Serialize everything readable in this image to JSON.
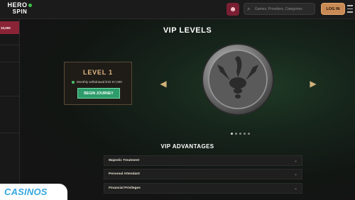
{
  "header": {
    "logo_line1": "HERO",
    "logo_line2": "SPIN",
    "search_placeholder": "Games, Providers, Categories",
    "login_label": "LOG IN",
    "avatar_icon": "profile-icon"
  },
  "sidebar": {
    "promo_text": "10,000"
  },
  "hero": {
    "title": "VIP LEVELS",
    "card": {
      "level": "LEVEL 1",
      "perk": "Monthly withdrawal limit €7,000",
      "button": "BEGIN JOURNEY"
    },
    "medallion_icon": "scorpion-medallion-icon",
    "prev_icon": "arrow-left-icon",
    "next_icon": "arrow-right-icon",
    "slides_total": 5,
    "slide_active": 1
  },
  "advantages": {
    "title": "VIP ADVANTAGES",
    "items": [
      {
        "label": "Majestic Treatment"
      },
      {
        "label": "Personal Attendant"
      },
      {
        "label": "Financial Privileges"
      }
    ]
  },
  "watermark": {
    "text": "CASINOS"
  },
  "colors": {
    "accent_gold": "#d1b17a",
    "login": "#c98a55",
    "journey_green": "#2e9b6b",
    "promo_red": "#8a2436"
  }
}
